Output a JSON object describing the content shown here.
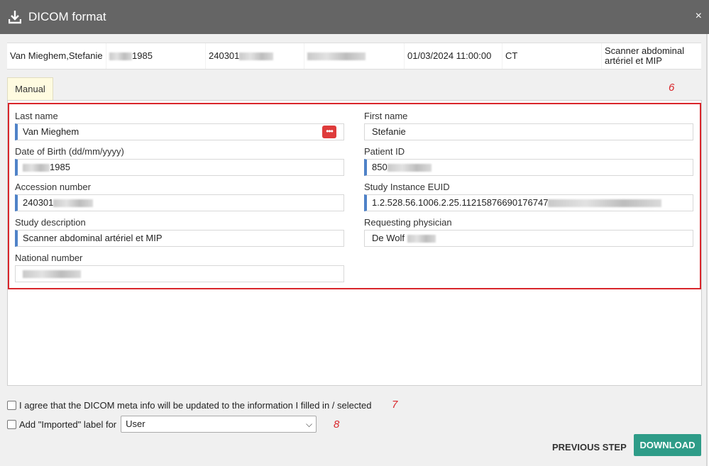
{
  "window": {
    "title": "DICOM format",
    "close_label": "×"
  },
  "study": {
    "name": "Van Mieghem,Stefanie",
    "dob_suffix": "1985",
    "accession_prefix": "240301",
    "datetime": "01/03/2024 11:00:00",
    "modality": "CT",
    "description": "Scanner abdominal artériel et MIP"
  },
  "tab": {
    "label": "Manual"
  },
  "annotations": {
    "n6": "6",
    "n7": "7",
    "n8": "8"
  },
  "form": {
    "last_name": {
      "label": "Last name",
      "value": "Van Mieghem",
      "more_glyph": "•••"
    },
    "first_name": {
      "label": "First name",
      "value": "Stefanie"
    },
    "dob": {
      "label": "Date of Birth (dd/mm/yyyy)",
      "value_suffix": "1985"
    },
    "patient_id": {
      "label": "Patient ID",
      "value_prefix": "850"
    },
    "accession": {
      "label": "Accession number",
      "value_prefix": "240301"
    },
    "euid": {
      "label": "Study Instance EUID",
      "value_prefix": "1.2.528.56.1006.2.25.11215876690176747"
    },
    "study_description": {
      "label": "Study description",
      "value": "Scanner abdominal artériel et MIP"
    },
    "physician": {
      "label": "Requesting physician",
      "value_prefix": "De Wolf"
    },
    "national_number": {
      "label": "National number"
    }
  },
  "options": {
    "agree_label": "I agree that the DICOM meta info will be updated to the information I filled in / selected",
    "imported_label": "Add \"Imported\" label for",
    "select_value": "User"
  },
  "buttons": {
    "previous": "PREVIOUS STEP",
    "download": "DOWNLOAD"
  },
  "icons": {
    "title": "download-icon",
    "close": "close-icon",
    "more": "more-dots-icon",
    "chevron": "chevron-down-icon"
  },
  "colors": {
    "titlebar": "#656565",
    "accent_marker": "#4f82c8",
    "highlight_box": "#d9262b",
    "download_button": "#2e9c88",
    "more_button": "#de3b3b"
  }
}
